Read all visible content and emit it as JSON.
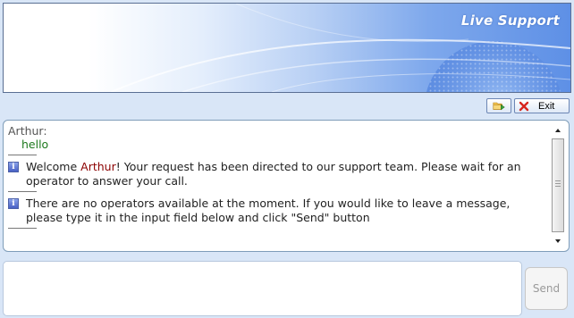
{
  "banner": {
    "title": "Live Support"
  },
  "toolbar": {
    "save_icon": "folder-save-icon",
    "exit_icon": "red-x-icon",
    "exit_label": "Exit"
  },
  "chat": {
    "sender": "Arthur:",
    "user_message": "hello",
    "system_messages": [
      {
        "before": "Welcome ",
        "username": "Arthur",
        "after": "! Your request has been directed to our support team. Please wait for an operator to answer your call."
      },
      {
        "text": "There are no operators available at the moment. If you would like to leave a message, please type it in the input field below and click \"Send\" button"
      }
    ],
    "info_icon": "info-icon"
  },
  "composer": {
    "value": "",
    "send_label": "Send"
  },
  "colors": {
    "username": "#8b0000",
    "user_message": "#1e7a1e",
    "banner_accent": "#5e90e6"
  }
}
